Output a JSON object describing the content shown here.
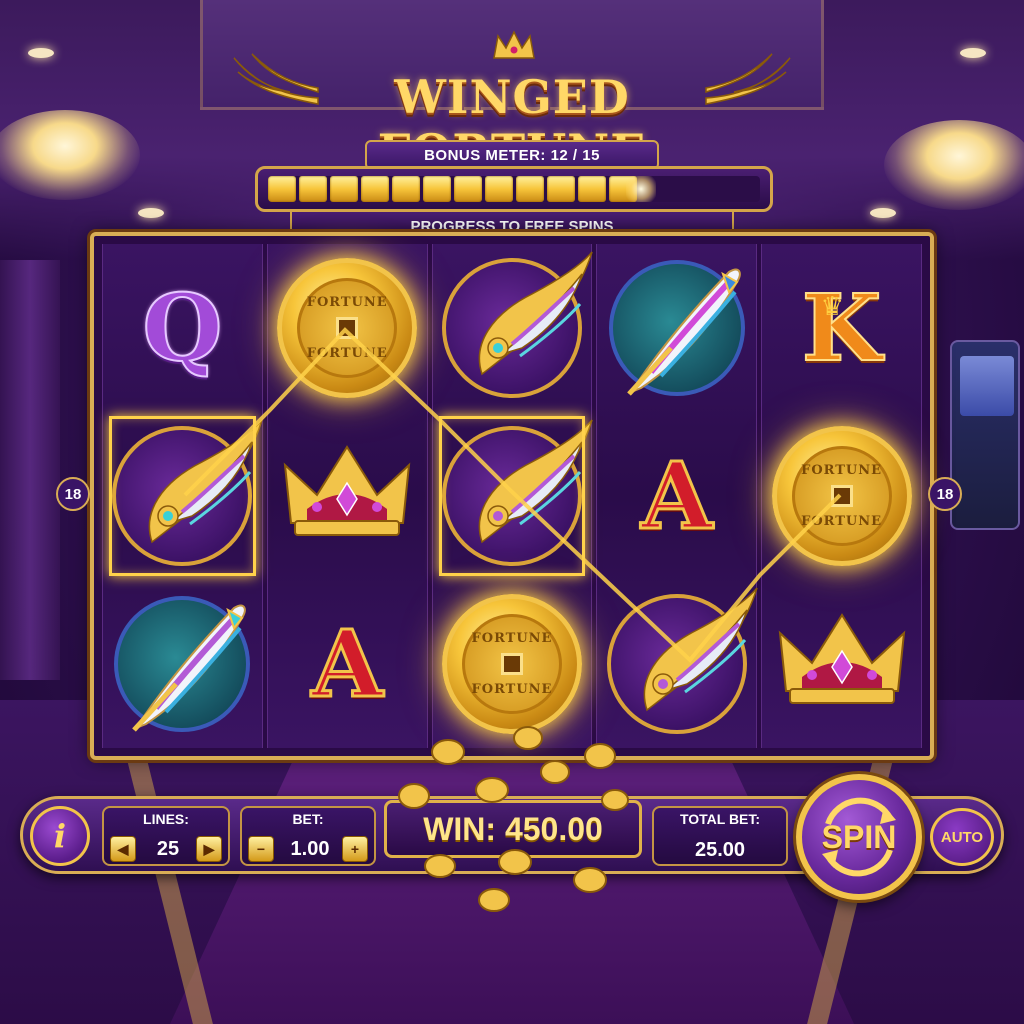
{
  "game": {
    "title": "WINGED FORTUNE"
  },
  "bonus_meter": {
    "label": "BONUS METER: 12 / 15",
    "current": 12,
    "max": 15,
    "subtitle": "PROGRESS TO FREE SPINS"
  },
  "paylines": {
    "left_number": "18",
    "right_number": "18"
  },
  "reels": [
    [
      "letter-Q",
      "fortune-coin",
      "blue-feather"
    ],
    [
      "fortune-coin",
      "gold-crown",
      "letter-A"
    ],
    [
      "golden-wing",
      "golden-wing",
      "fortune-coin"
    ],
    [
      "blue-feather",
      "letter-A",
      "golden-wing"
    ],
    [
      "letter-K",
      "fortune-coin",
      "gold-crown"
    ]
  ],
  "symbols": {
    "q": "Q",
    "a": "A",
    "k": "K",
    "coin_top": "FORTUNE",
    "coin_bottom": "FORTUNE"
  },
  "controls": {
    "lines_label": "LINES:",
    "lines_value": "25",
    "bet_label": "BET:",
    "bet_value": "1.00",
    "win_label": "WIN:",
    "win_value": "450.00",
    "win_text": "WIN: 450.00",
    "total_bet_label": "TOTAL BET:",
    "total_bet_value": "25.00",
    "spin_label": "SPIN",
    "auto_label": "AUTO",
    "info_label": "i",
    "bet_minus": "−",
    "bet_plus": "+"
  },
  "colors": {
    "gold": "#f2c44a",
    "purple_bg": "#2d0f4d",
    "win_text": "#ffe58a",
    "accent_red": "#d21d2a"
  }
}
